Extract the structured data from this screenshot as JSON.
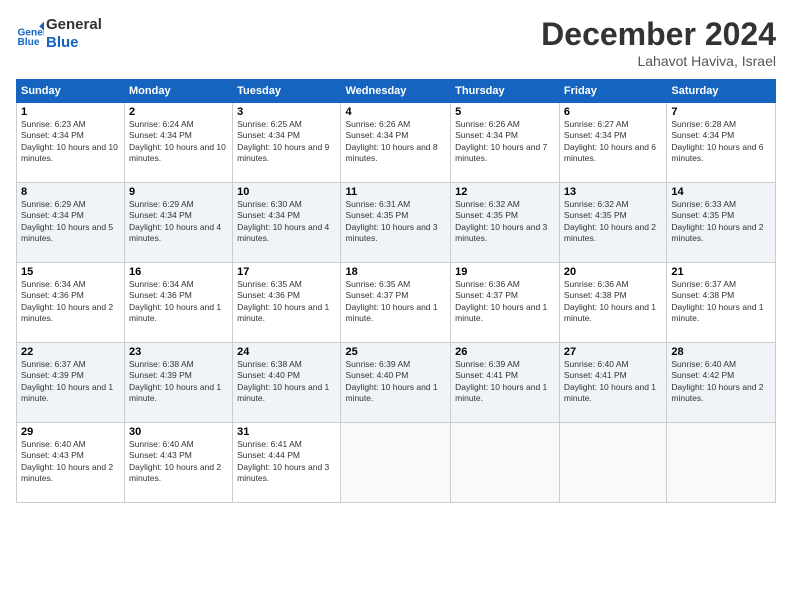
{
  "header": {
    "logo_line1": "General",
    "logo_line2": "Blue",
    "month_title": "December 2024",
    "location": "Lahavot Haviva, Israel"
  },
  "days_of_week": [
    "Sunday",
    "Monday",
    "Tuesday",
    "Wednesday",
    "Thursday",
    "Friday",
    "Saturday"
  ],
  "weeks": [
    [
      {
        "day": "1",
        "sunrise": "6:23 AM",
        "sunset": "4:34 PM",
        "daylight": "10 hours and 10 minutes."
      },
      {
        "day": "2",
        "sunrise": "6:24 AM",
        "sunset": "4:34 PM",
        "daylight": "10 hours and 10 minutes."
      },
      {
        "day": "3",
        "sunrise": "6:25 AM",
        "sunset": "4:34 PM",
        "daylight": "10 hours and 9 minutes."
      },
      {
        "day": "4",
        "sunrise": "6:26 AM",
        "sunset": "4:34 PM",
        "daylight": "10 hours and 8 minutes."
      },
      {
        "day": "5",
        "sunrise": "6:26 AM",
        "sunset": "4:34 PM",
        "daylight": "10 hours and 7 minutes."
      },
      {
        "day": "6",
        "sunrise": "6:27 AM",
        "sunset": "4:34 PM",
        "daylight": "10 hours and 6 minutes."
      },
      {
        "day": "7",
        "sunrise": "6:28 AM",
        "sunset": "4:34 PM",
        "daylight": "10 hours and 6 minutes."
      }
    ],
    [
      {
        "day": "8",
        "sunrise": "6:29 AM",
        "sunset": "4:34 PM",
        "daylight": "10 hours and 5 minutes."
      },
      {
        "day": "9",
        "sunrise": "6:29 AM",
        "sunset": "4:34 PM",
        "daylight": "10 hours and 4 minutes."
      },
      {
        "day": "10",
        "sunrise": "6:30 AM",
        "sunset": "4:34 PM",
        "daylight": "10 hours and 4 minutes."
      },
      {
        "day": "11",
        "sunrise": "6:31 AM",
        "sunset": "4:35 PM",
        "daylight": "10 hours and 3 minutes."
      },
      {
        "day": "12",
        "sunrise": "6:32 AM",
        "sunset": "4:35 PM",
        "daylight": "10 hours and 3 minutes."
      },
      {
        "day": "13",
        "sunrise": "6:32 AM",
        "sunset": "4:35 PM",
        "daylight": "10 hours and 2 minutes."
      },
      {
        "day": "14",
        "sunrise": "6:33 AM",
        "sunset": "4:35 PM",
        "daylight": "10 hours and 2 minutes."
      }
    ],
    [
      {
        "day": "15",
        "sunrise": "6:34 AM",
        "sunset": "4:36 PM",
        "daylight": "10 hours and 2 minutes."
      },
      {
        "day": "16",
        "sunrise": "6:34 AM",
        "sunset": "4:36 PM",
        "daylight": "10 hours and 1 minute."
      },
      {
        "day": "17",
        "sunrise": "6:35 AM",
        "sunset": "4:36 PM",
        "daylight": "10 hours and 1 minute."
      },
      {
        "day": "18",
        "sunrise": "6:35 AM",
        "sunset": "4:37 PM",
        "daylight": "10 hours and 1 minute."
      },
      {
        "day": "19",
        "sunrise": "6:36 AM",
        "sunset": "4:37 PM",
        "daylight": "10 hours and 1 minute."
      },
      {
        "day": "20",
        "sunrise": "6:36 AM",
        "sunset": "4:38 PM",
        "daylight": "10 hours and 1 minute."
      },
      {
        "day": "21",
        "sunrise": "6:37 AM",
        "sunset": "4:38 PM",
        "daylight": "10 hours and 1 minute."
      }
    ],
    [
      {
        "day": "22",
        "sunrise": "6:37 AM",
        "sunset": "4:39 PM",
        "daylight": "10 hours and 1 minute."
      },
      {
        "day": "23",
        "sunrise": "6:38 AM",
        "sunset": "4:39 PM",
        "daylight": "10 hours and 1 minute."
      },
      {
        "day": "24",
        "sunrise": "6:38 AM",
        "sunset": "4:40 PM",
        "daylight": "10 hours and 1 minute."
      },
      {
        "day": "25",
        "sunrise": "6:39 AM",
        "sunset": "4:40 PM",
        "daylight": "10 hours and 1 minute."
      },
      {
        "day": "26",
        "sunrise": "6:39 AM",
        "sunset": "4:41 PM",
        "daylight": "10 hours and 1 minute."
      },
      {
        "day": "27",
        "sunrise": "6:40 AM",
        "sunset": "4:41 PM",
        "daylight": "10 hours and 1 minute."
      },
      {
        "day": "28",
        "sunrise": "6:40 AM",
        "sunset": "4:42 PM",
        "daylight": "10 hours and 2 minutes."
      }
    ],
    [
      {
        "day": "29",
        "sunrise": "6:40 AM",
        "sunset": "4:43 PM",
        "daylight": "10 hours and 2 minutes."
      },
      {
        "day": "30",
        "sunrise": "6:40 AM",
        "sunset": "4:43 PM",
        "daylight": "10 hours and 2 minutes."
      },
      {
        "day": "31",
        "sunrise": "6:41 AM",
        "sunset": "4:44 PM",
        "daylight": "10 hours and 3 minutes."
      },
      null,
      null,
      null,
      null
    ]
  ]
}
